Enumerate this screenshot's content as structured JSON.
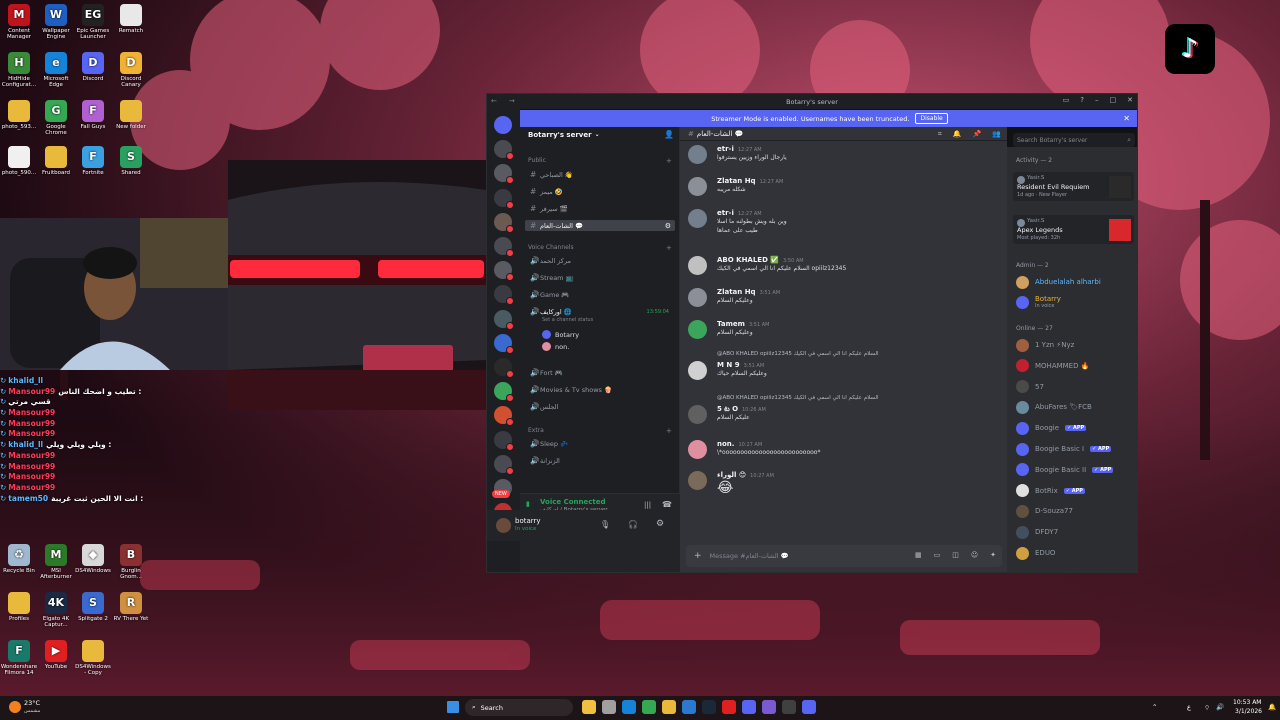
{
  "desktop": {
    "icons": [
      {
        "label": "Content Manager",
        "icon": "content-manager-icon",
        "color": "#c0141c",
        "glyph": "M"
      },
      {
        "label": "Wallpaper Engine",
        "icon": "wallpaper-engine-icon",
        "color": "#1f5fbf",
        "glyph": "W"
      },
      {
        "label": "Epic Games Launcher",
        "icon": "epic-games-icon",
        "color": "#222222",
        "glyph": "EG"
      },
      {
        "label": "Rematch",
        "icon": "file-icon",
        "color": "#e8e8e8",
        "glyph": ""
      },
      {
        "label": "HidHide Configurat...",
        "icon": "hidhide-icon",
        "color": "#3a8a3a",
        "glyph": "H"
      },
      {
        "label": "Microsoft Edge",
        "icon": "edge-icon",
        "color": "#1583d8",
        "glyph": "e"
      },
      {
        "label": "Discord",
        "icon": "discord-icon",
        "color": "#5865f2",
        "glyph": "D"
      },
      {
        "label": "Discord Canary",
        "icon": "discord-canary-icon",
        "color": "#f0b232",
        "glyph": "D"
      },
      {
        "label": "photo_593...",
        "icon": "folder-icon",
        "color": "#e8b93a",
        "glyph": ""
      },
      {
        "label": "Google Chrome",
        "icon": "chrome-icon",
        "color": "#34a853",
        "glyph": "G"
      },
      {
        "label": "Fall Guys",
        "icon": "fall-guys-icon",
        "color": "#b060d0",
        "glyph": "F"
      },
      {
        "label": "New folder",
        "icon": "folder-icon",
        "color": "#e8b93a",
        "glyph": ""
      },
      {
        "label": "photo_590...",
        "icon": "file-icon",
        "color": "#f0f0f0",
        "glyph": ""
      },
      {
        "label": "Fruitboard",
        "icon": "folder-icon",
        "color": "#e8b93a",
        "glyph": ""
      },
      {
        "label": "Fortnite",
        "icon": "fortnite-icon",
        "color": "#3aa0e0",
        "glyph": "F"
      },
      {
        "label": "Shared",
        "icon": "shared-icon",
        "color": "#2aa060",
        "glyph": "S"
      }
    ],
    "bottom_icons": [
      {
        "label": "Recycle Bin",
        "icon": "recycle-bin-icon",
        "color": "#9fb8d0",
        "glyph": "♻"
      },
      {
        "label": "MSI Afterburner",
        "icon": "msi-afterburner-icon",
        "color": "#2a7a2a",
        "glyph": "M"
      },
      {
        "label": "DS4Windows",
        "icon": "ds4windows-icon",
        "color": "#d8d8d8",
        "glyph": "◆"
      },
      {
        "label": "Burglin Gnom...",
        "icon": "burglin-gnomes-icon",
        "color": "#8a3030",
        "glyph": "B"
      },
      {
        "label": "Profiles",
        "icon": "folder-icon",
        "color": "#e8b93a",
        "glyph": ""
      },
      {
        "label": "Elgato 4K Captur...",
        "icon": "elgato-icon",
        "color": "#1a2a44",
        "glyph": "4K"
      },
      {
        "label": "Splitgate 2",
        "icon": "splitgate-icon",
        "color": "#3a6ad0",
        "glyph": "S"
      },
      {
        "label": "RV There Yet",
        "icon": "rv-there-yet-icon",
        "color": "#d09040",
        "glyph": "R"
      },
      {
        "label": "Wondershare Filmora 14",
        "icon": "filmora-icon",
        "color": "#1a7a6a",
        "glyph": "F"
      },
      {
        "label": "YouTube",
        "icon": "youtube-icon",
        "color": "#e02020",
        "glyph": "▶"
      },
      {
        "label": "DS4Windows - Copy",
        "icon": "folder-icon",
        "color": "#e8b93a",
        "glyph": ""
      }
    ],
    "tiktok_icon": "tiktok-icon"
  },
  "stream_chat": [
    {
      "user": "khalid_ll",
      "text": "",
      "ucolor": "#5ab8ff"
    },
    {
      "user": "Mansour99",
      "text": "تطيب و اضحك الناس :",
      "ucolor": "#ff3b5c"
    },
    {
      "user": "",
      "text": "قسي مرتي",
      "ucolor": "#ff3b5c"
    },
    {
      "user": "Mansour99",
      "text": "",
      "ucolor": "#ff3b5c"
    },
    {
      "user": "Mansour99",
      "text": "",
      "ucolor": "#ff3b5c"
    },
    {
      "user": "Mansour99",
      "text": "",
      "ucolor": "#ff3b5c"
    },
    {
      "user": "khalid_ll",
      "text": "ويلي ويلي ويلي :",
      "ucolor": "#5ab8ff"
    },
    {
      "user": "Mansour99",
      "text": "",
      "ucolor": "#ff3b5c"
    },
    {
      "user": "Mansour99",
      "text": "",
      "ucolor": "#ff3b5c"
    },
    {
      "user": "Mansour99",
      "text": "",
      "ucolor": "#ff3b5c"
    },
    {
      "user": "Mansour99",
      "text": "",
      "ucolor": "#ff3b5c"
    },
    {
      "user": "tamem50",
      "text": "انت الا الحين ثبت غريبة :",
      "ucolor": "#5ab8ff"
    }
  ],
  "discord": {
    "window_title": "Botarry's server",
    "banner": {
      "text": "Streamer Mode is enabled. Usernames have been truncated.",
      "button": "Disable"
    },
    "server_name": "Botarry's server",
    "categories": {
      "public": "Public",
      "voice": "Voice Channels",
      "extra": "Extra"
    },
    "text_channels": [
      {
        "name": "الصباحي 👋",
        "sel": false
      },
      {
        "name": "ميمز 🤣",
        "sel": false
      },
      {
        "name": "سيرفر 🎬",
        "sel": false
      },
      {
        "name": "الشات-العام 💬",
        "sel": true
      }
    ],
    "voice_channels_top": [
      {
        "name": "مركز الحمد"
      },
      {
        "name": "Stream 📺"
      },
      {
        "name": "Game 🎮"
      }
    ],
    "active_voice": {
      "name": "اوركايف 🌐",
      "status": "Set a channel status",
      "timer": "13:59:04"
    },
    "voice_users": [
      {
        "name": "Botarry"
      },
      {
        "name": "non."
      }
    ],
    "voice_channels_bottom": [
      {
        "name": "Fort 🎮"
      },
      {
        "name": "Movies & Tv shows 🍿"
      },
      {
        "name": "الجلس"
      }
    ],
    "extra_channels": [
      {
        "name": "Sleep 💤"
      },
      {
        "name": "الزنزانة"
      }
    ],
    "voice_panel": {
      "status": "Voice Connected",
      "sub": "اوركايف / Botarry's server"
    },
    "user": {
      "name": "botarry",
      "status": "In voice"
    },
    "new_badge": "NEW",
    "channel_header": "الشات-العام 💬",
    "messages": [
      {
        "name": "etr-i",
        "time": "12:27 AM",
        "text": "يارجال الوراء وزيين يسترفوا",
        "text2": "",
        "reply": "",
        "color": "#747f8d"
      },
      {
        "name": "Zlatan Hq",
        "time": "12:27 AM",
        "text": "شكله مريبه",
        "text2": "",
        "reply": "",
        "color": "#8a8f98"
      },
      {
        "name": "etr-i",
        "time": "12:27 AM",
        "text": "وين بله ويش بطولنه ما اسلا",
        "text2": "طيب على عماها",
        "reply": "",
        "color": "#747f8d"
      },
      {
        "name": "ABO KHALED ✅",
        "time": "3:50 AM",
        "text": "السلام عليكم انا الي اسمي في الكيك opiilz12345",
        "text2": "",
        "reply": "",
        "color": "#c0c0c0"
      },
      {
        "name": "Zlatan Hq",
        "time": "3:51 AM",
        "text": "وعليكم السلام",
        "text2": "",
        "reply": "",
        "color": "#8a8f98"
      },
      {
        "name": "Tamem",
        "time": "3:51 AM",
        "text": "وعليكم السلام",
        "text2": "",
        "reply": "",
        "color": "#3ba55c"
      },
      {
        "name": "M N 9",
        "time": "3:51 AM",
        "text": "وعليكم السلام حياك",
        "text2": "",
        "reply": "@ABO KHALED opiilz12345 السلام عليكم انا الي اسمي في الكيك",
        "color": "#d0d0d0"
      },
      {
        "name": "5 ట O",
        "time": "10:26 AM",
        "text": "عليكم السلام",
        "text2": "",
        "reply": "@ABO KHALED opiilz12345 السلام عليكم انا الي اسمي في الكيك",
        "color": "#606060"
      },
      {
        "name": "non.",
        "time": "10:27 AM",
        "text": "\\*oooooooooooooooooooooooooo*",
        "text2": "",
        "reply": "",
        "color": "#e08fa0"
      },
      {
        "name": "الوراء 😊",
        "time": "10:27 AM",
        "text": "😂",
        "text2": "",
        "reply": "",
        "color": "#7a6a5a"
      }
    ],
    "composer_placeholder": "Message #الشات-العام 💬",
    "search_placeholder": "Search Botarry's server",
    "members": {
      "activity_label": "Activity — 2",
      "activities": [
        {
          "user": "Yasir.S",
          "game": "Resident Evil Requiem",
          "meta": "1d ago · New Player"
        },
        {
          "user": "Yasir.S",
          "game": "Apex Legends",
          "meta": "Most played: 32h"
        }
      ],
      "admin_label": "Admin — 2",
      "admins": [
        {
          "name": "Abduelalah alharbi",
          "sub": "",
          "color": "#5ab8ff",
          "av": "#d0a060"
        },
        {
          "name": "Botarry",
          "sub": "In voice",
          "color": "#f0b232",
          "av": "#5865f2"
        }
      ],
      "online_label": "Online — 27",
      "online": [
        {
          "name": "1 Yzn ⚡Nyz",
          "app": "",
          "av": "#a06040"
        },
        {
          "name": "MOHAMMED 🔥",
          "app": "",
          "av": "#c02030"
        },
        {
          "name": "57",
          "app": "",
          "av": "#4a4a4a"
        },
        {
          "name": "AbuFares 🏷FCB",
          "app": "",
          "av": "#6a8aa0"
        },
        {
          "name": "Boogie",
          "app": "✓ APP",
          "av": "#5865f2"
        },
        {
          "name": "Boogie Basic I",
          "app": "✓ APP",
          "av": "#5865f2"
        },
        {
          "name": "Boogie Basic II",
          "app": "✓ APP",
          "av": "#5865f2"
        },
        {
          "name": "BotRix",
          "app": "✓ APP",
          "av": "#e0e0e0"
        },
        {
          "name": "D-Souza77",
          "app": "",
          "av": "#605040"
        },
        {
          "name": "DFDY7",
          "app": "",
          "av": "#405060"
        },
        {
          "name": "EDUO",
          "app": "",
          "av": "#d0a040"
        }
      ]
    }
  },
  "taskbar": {
    "weather": "23°C",
    "weather_sub": "مشمس",
    "search": "Search",
    "lang": "ع",
    "time": "10:53 AM",
    "date": "3/1/2026"
  }
}
